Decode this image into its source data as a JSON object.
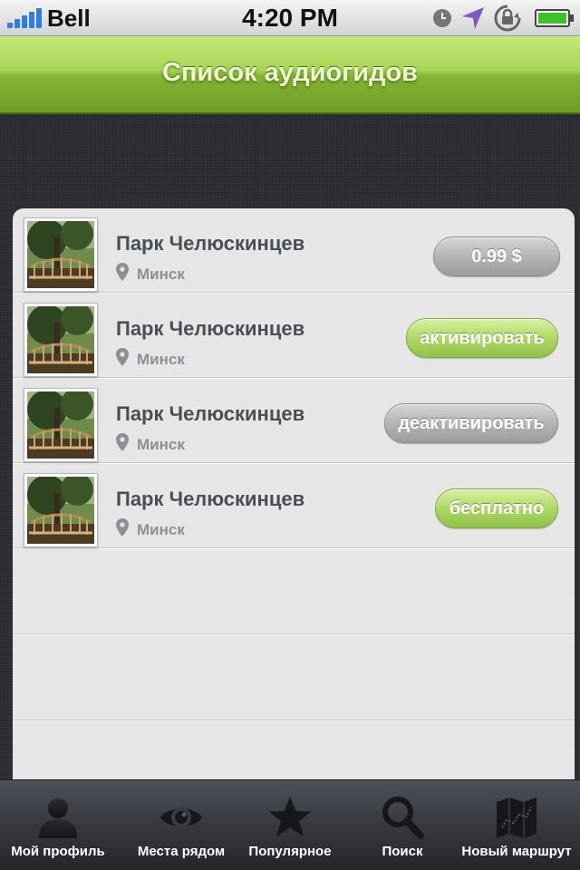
{
  "status_bar": {
    "carrier": "Bell",
    "time": "4:20 PM",
    "icons": [
      "signal-icon",
      "alarm-icon",
      "location-arrow-icon",
      "rotation-lock-icon",
      "battery-icon"
    ]
  },
  "header": {
    "title": "Список аудиогидов"
  },
  "colors": {
    "header_green": "#9fd050",
    "title_text": "#eef9cf",
    "row_title": "#4a4e57",
    "button_green": "#afd865",
    "button_gray": "#b4b4b4",
    "background_dark": "#2c2e34",
    "list_background": "#e6e6e6"
  },
  "list": {
    "items": [
      {
        "title": "Парк Челюскинцев",
        "city": "Минск",
        "button": "0.99 $",
        "button_style": "gray"
      },
      {
        "title": "Парк Челюскинцев",
        "city": "Минск",
        "button": "активировать",
        "button_style": "green"
      },
      {
        "title": "Парк Челюскинцев",
        "city": "Минск",
        "button": "деактивировать",
        "button_style": "gray"
      },
      {
        "title": "Парк Челюскинцев",
        "city": "Минск",
        "button": "бесплатно",
        "button_style": "green"
      }
    ]
  },
  "tabbar": {
    "tabs": [
      {
        "label": "Мой профиль",
        "icon": "person-icon"
      },
      {
        "label": "Места рядом",
        "icon": "eye-icon"
      },
      {
        "label": "Популярное",
        "icon": "star-icon"
      },
      {
        "label": "Поиск",
        "icon": "search-icon"
      },
      {
        "label": "Новый маршрут",
        "icon": "map-icon"
      }
    ]
  }
}
